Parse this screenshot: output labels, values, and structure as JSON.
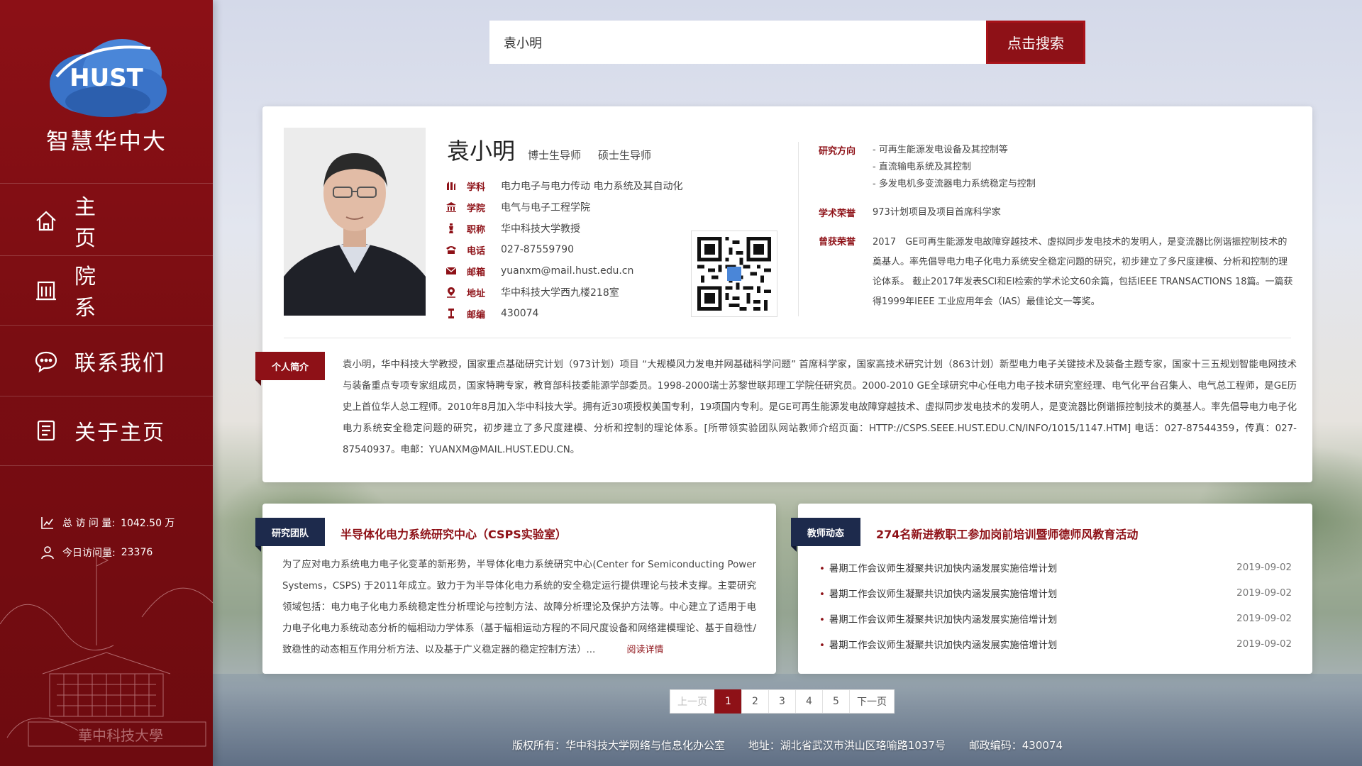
{
  "brand": {
    "logo_text": "智慧华中大",
    "logo_mark": "HUST"
  },
  "nav": [
    {
      "label": "主 页",
      "icon": "home-icon"
    },
    {
      "label": "院 系",
      "icon": "building-icon"
    },
    {
      "label": "联系我们",
      "icon": "chat-icon"
    },
    {
      "label": "关于主页",
      "icon": "document-icon"
    }
  ],
  "stats": {
    "total_label": "总 访 问 量:",
    "total_value": "1042.50 万",
    "today_label": "今日访问量:",
    "today_value": "23376"
  },
  "campus_text": "華中科技大學",
  "search": {
    "value": "袁小明",
    "button": "点击搜索"
  },
  "profile": {
    "name": "袁小明",
    "titles": [
      "博士生导师",
      "硕士生导师"
    ],
    "info": [
      {
        "icon": "discipline-icon",
        "label": "学科",
        "value": "电力电子与电力传动 电力系统及其自动化"
      },
      {
        "icon": "college-icon",
        "label": "学院",
        "value": "电气与电子工程学院"
      },
      {
        "icon": "rank-icon",
        "label": "职称",
        "value": "华中科技大学教授"
      },
      {
        "icon": "phone-icon",
        "label": "电话",
        "value": "027-87559790"
      },
      {
        "icon": "mail-icon",
        "label": "邮箱",
        "value": "yuanxm@mail.hust.edu.cn"
      },
      {
        "icon": "location-icon",
        "label": "地址",
        "value": "华中科技大学西九楼218室"
      },
      {
        "icon": "postcode-icon",
        "label": "邮编",
        "value": "430074"
      }
    ],
    "research_label": "研究方向",
    "research": [
      "- 可再生能源发电设备及其控制等",
      "- 直流输电系统及其控制",
      "- 多发电机多变流器电力系统稳定与控制"
    ],
    "honor_label": "学术荣誉",
    "honor": "973计划项目及项目首席科学家",
    "award_label": "曾获荣誉",
    "award": "2017　GE可再生能源发电故障穿越技术、虚拟同步发电技术的发明人，是变流器比例谐振控制技术的奠基人。率先倡导电力电子化电力系统安全稳定问题的研究，初步建立了多尺度建模、分析和控制的理论体系。 截止2017年发表SCI和EI检索的学术论文60余篇，包括IEEE TRANSACTIONS 18篇。一篇获得1999年IEEE 工业应用年会（IAS）最佳论文一等奖。",
    "bio_tag": "个人简介",
    "bio": "袁小明，华中科技大学教授，国家重点基础研究计划（973计划）项目 “大规模风力发电并网基础科学问题” 首席科学家，国家高技术研究计划（863计划）新型电力电子关键技术及装备主题专家，国家十三五规划智能电网技术与装备重点专项专家组成员，国家特聘专家，教育部科技委能源学部委员。1998-2000瑞士苏黎世联邦理工学院任研究员。2000-2010 GE全球研究中心任电力电子技术研究室经理、电气化平台召集人、电气总工程师，是GE历史上首位华人总工程师。2010年8月加入华中科技大学。拥有近30项授权美国专利，19项国内专利。是GE可再生能源发电故障穿越技术、虚拟同步发电技术的发明人，是变流器比例谐振控制技术的奠基人。率先倡导电力电子化电力系统安全稳定问题的研究，初步建立了多尺度建模、分析和控制的理论体系。[所带领实验团队网站教师介绍页面：HTTP://CSPS.SEEE.HUST.EDU.CN/INFO/1015/1147.HTM] 电话：027-87544359，传真：027-87540937。电邮：YUANXM@MAIL.HUST.EDU.CN。"
  },
  "team": {
    "tag": "研究团队",
    "title": "半导体化电力系统研究中心（CSPS实验室）",
    "text": "为了应对电力系统电力电子化变革的新形势，半导体化电力系统研究中心(Center for Semiconducting Power Systems，CSPS) 于2011年成立。致力于为半导体化电力系统的安全稳定运行提供理论与技术支撑。主要研究领域包括：电力电子化电力系统稳定性分析理论与控制方法、故障分析理论及保护方法等。中心建立了适用于电力电子化电力系统动态分析的幅相动力学体系（基于幅相运动方程的不同尺度设备和网络建模理论、基于自稳性/致稳性的动态相互作用分析方法、以及基于广义稳定器的稳定控制方法）...",
    "read_more": "阅读详情"
  },
  "news": {
    "tag": "教师动态",
    "title": "274名新进教职工参加岗前培训暨师德师风教育活动",
    "items": [
      {
        "title": "暑期工作会议师生凝聚共识加快内涵发展实施倍增计划",
        "date": "2019-09-02"
      },
      {
        "title": "暑期工作会议师生凝聚共识加快内涵发展实施倍增计划",
        "date": "2019-09-02"
      },
      {
        "title": "暑期工作会议师生凝聚共识加快内涵发展实施倍增计划",
        "date": "2019-09-02"
      },
      {
        "title": "暑期工作会议师生凝聚共识加快内涵发展实施倍增计划",
        "date": "2019-09-02"
      }
    ]
  },
  "pager": {
    "prev": "上一页",
    "pages": [
      "1",
      "2",
      "3",
      "4",
      "5"
    ],
    "next": "下一页",
    "current": "1"
  },
  "footer": {
    "copyright": "版权所有：华中科技大学网络与信息化办公室",
    "address": "地址：湖北省武汉市洪山区珞喻路1037号",
    "postcode": "邮政编码：430074"
  },
  "colors": {
    "brand_red": "#8e1117",
    "navy": "#1d2a4c"
  }
}
